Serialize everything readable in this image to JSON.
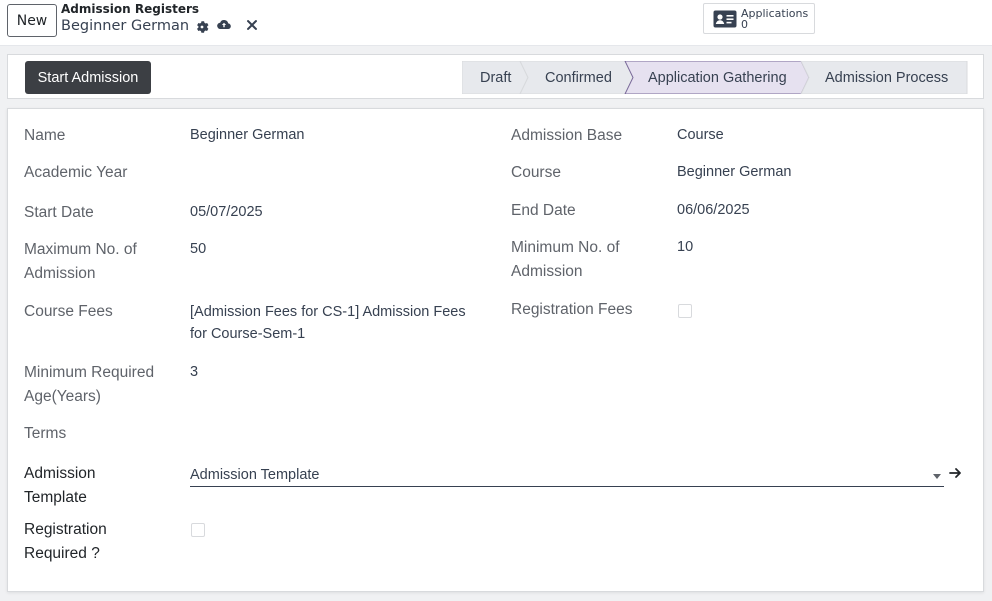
{
  "topbar": {
    "new_label": "New",
    "breadcrumb_parent": "Admission Registers",
    "breadcrumb_current": "Beginner German",
    "icons": [
      "gear-icon",
      "cloud-upload-icon",
      "close-icon"
    ],
    "smart_button": {
      "label": "Applications",
      "count": "0",
      "icon": "id-card-icon"
    }
  },
  "statusbar": {
    "action_label": "Start Admission",
    "stages": [
      {
        "label": "Draft",
        "active": false
      },
      {
        "label": "Confirmed",
        "active": false
      },
      {
        "label": "Application Gathering",
        "active": true
      },
      {
        "label": "Admission Process",
        "active": false
      }
    ],
    "active_color": "#e6e1f0",
    "inactive_color": "#e7e9ed"
  },
  "form": {
    "left": [
      {
        "label": "Name",
        "value": "Beginner German"
      },
      {
        "label": "Academic Year",
        "value": ""
      },
      {
        "label": "Start Date",
        "value": "05/07/2025"
      },
      {
        "label_line1": "Maximum No. of",
        "label_line2": "Admission",
        "value": "50"
      },
      {
        "label": "Course Fees",
        "value_line1": "[Admission Fees for CS-1] Admission Fees",
        "value_line2": "for Course-Sem-1"
      },
      {
        "label_line1": "Minimum Required",
        "label_line2": "Age(Years)",
        "value": "3"
      },
      {
        "label": "Terms",
        "value": ""
      }
    ],
    "right": [
      {
        "label": "Admission Base",
        "value": "Course"
      },
      {
        "label": "Course",
        "value": "Beginner German"
      },
      {
        "label": "End Date",
        "value": "06/06/2025"
      },
      {
        "label_line1": "Minimum No. of",
        "label_line2": "Admission",
        "value": "10"
      },
      {
        "label": "Registration Fees",
        "checked": false
      }
    ],
    "admission_template": {
      "label_line1": "Admission",
      "label_line2": "Template",
      "value": "Admission Template"
    },
    "registration_required": {
      "label_line1": "Registration",
      "label_line2": "Required ?",
      "checked": false
    }
  }
}
